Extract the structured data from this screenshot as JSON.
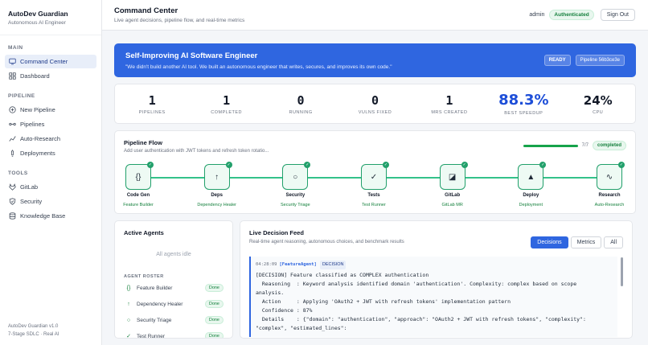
{
  "sidebar": {
    "title": "AutoDev Guardian",
    "subtitle": "Autonomous AI Engineer",
    "sections": [
      {
        "label": "MAIN",
        "items": [
          {
            "label": "Command Center",
            "icon": "monitor-icon",
            "active": true
          },
          {
            "label": "Dashboard",
            "icon": "grid-icon"
          }
        ]
      },
      {
        "label": "PIPELINE",
        "items": [
          {
            "label": "New Pipeline",
            "icon": "plus-circle-icon"
          },
          {
            "label": "Pipelines",
            "icon": "branch-icon"
          },
          {
            "label": "Auto-Research",
            "icon": "chart-icon"
          },
          {
            "label": "Deployments",
            "icon": "rocket-icon"
          }
        ]
      },
      {
        "label": "TOOLS",
        "items": [
          {
            "label": "GitLab",
            "icon": "gitlab-icon"
          },
          {
            "label": "Security",
            "icon": "shield-icon"
          },
          {
            "label": "Knowledge Base",
            "icon": "database-icon"
          }
        ]
      }
    ],
    "footer_line1": "AutoDev Guardian v1.0",
    "footer_line2": "7-Stage SDLC · Real AI"
  },
  "header": {
    "title": "Command Center",
    "subtitle": "Live agent decisions, pipeline flow, and real-time metrics",
    "user": "admin",
    "auth_badge": "Authenticated",
    "signout": "Sign Out"
  },
  "hero": {
    "title": "Self-Improving AI Software Engineer",
    "quote": "\"We didn't build another AI tool. We built an autonomous engineer that writes, secures, and improves its own code.\"",
    "status": "READY",
    "pipeline": "Pipeline 56b3ce3e"
  },
  "stats": [
    {
      "value": "1",
      "label": "PIPELINES"
    },
    {
      "value": "1",
      "label": "COMPLETED"
    },
    {
      "value": "0",
      "label": "RUNNING"
    },
    {
      "value": "0",
      "label": "VULNS FIXED"
    },
    {
      "value": "1",
      "label": "MRS CREATED"
    },
    {
      "value": "88.3%",
      "label": "BEST SPEEDUP"
    },
    {
      "value": "24%",
      "label": "CPU"
    }
  ],
  "pipeline": {
    "title": "Pipeline Flow",
    "subtitle": "Add user authentication with JWT tokens and refresh token rotatio...",
    "count": "7/7",
    "progress": 1.0,
    "status": "completed",
    "stages": [
      {
        "name": "Code Gen",
        "agent": "Feature Builder",
        "glyph": "{}"
      },
      {
        "name": "Deps",
        "agent": "Dependency Healer",
        "glyph": "↑"
      },
      {
        "name": "Security",
        "agent": "Security Triage",
        "glyph": "○"
      },
      {
        "name": "Tests",
        "agent": "Test Runner",
        "glyph": "✓"
      },
      {
        "name": "GitLab",
        "agent": "GitLab MR",
        "glyph": "◪"
      },
      {
        "name": "Deploy",
        "agent": "Deployment",
        "glyph": "▲"
      },
      {
        "name": "Research",
        "agent": "Auto-Research",
        "glyph": "∿"
      }
    ]
  },
  "agents": {
    "title": "Active Agents",
    "idle": "All agents idle",
    "roster_title": "AGENT ROSTER",
    "roster": [
      {
        "name": "Feature Builder",
        "status": "Done",
        "glyph": "{}"
      },
      {
        "name": "Dependency Healer",
        "status": "Done",
        "glyph": "↑"
      },
      {
        "name": "Security Triage",
        "status": "Done",
        "glyph": "○"
      },
      {
        "name": "Test Runner",
        "status": "Done",
        "glyph": "✓"
      }
    ]
  },
  "feed": {
    "title": "Live Decision Feed",
    "subtitle": "Real-time agent reasoning, autonomous choices, and benchmark results",
    "tabs": [
      {
        "label": "Decisions",
        "active": true
      },
      {
        "label": "Metrics"
      },
      {
        "label": "All"
      }
    ],
    "entry": {
      "time": "04:28:09",
      "agent": "[FeatureAgent]",
      "tag": "DECISION",
      "lines": [
        "[DECISION] Feature classified as COMPLEX authentication",
        "  Reasoning  : Keyword analysis identified domain 'authentication'. Complexity: complex based on scope",
        "analysis.",
        "  Action     : Applying 'OAuth2 + JWT with refresh tokens' implementation pattern",
        "  Confidence : 87%",
        "  Details    : {\"domain\": \"authentication\", \"approach\": \"OAuth2 + JWT with refresh tokens\", \"complexity\":",
        "\"complex\", \"estimated_lines\":"
      ]
    }
  }
}
